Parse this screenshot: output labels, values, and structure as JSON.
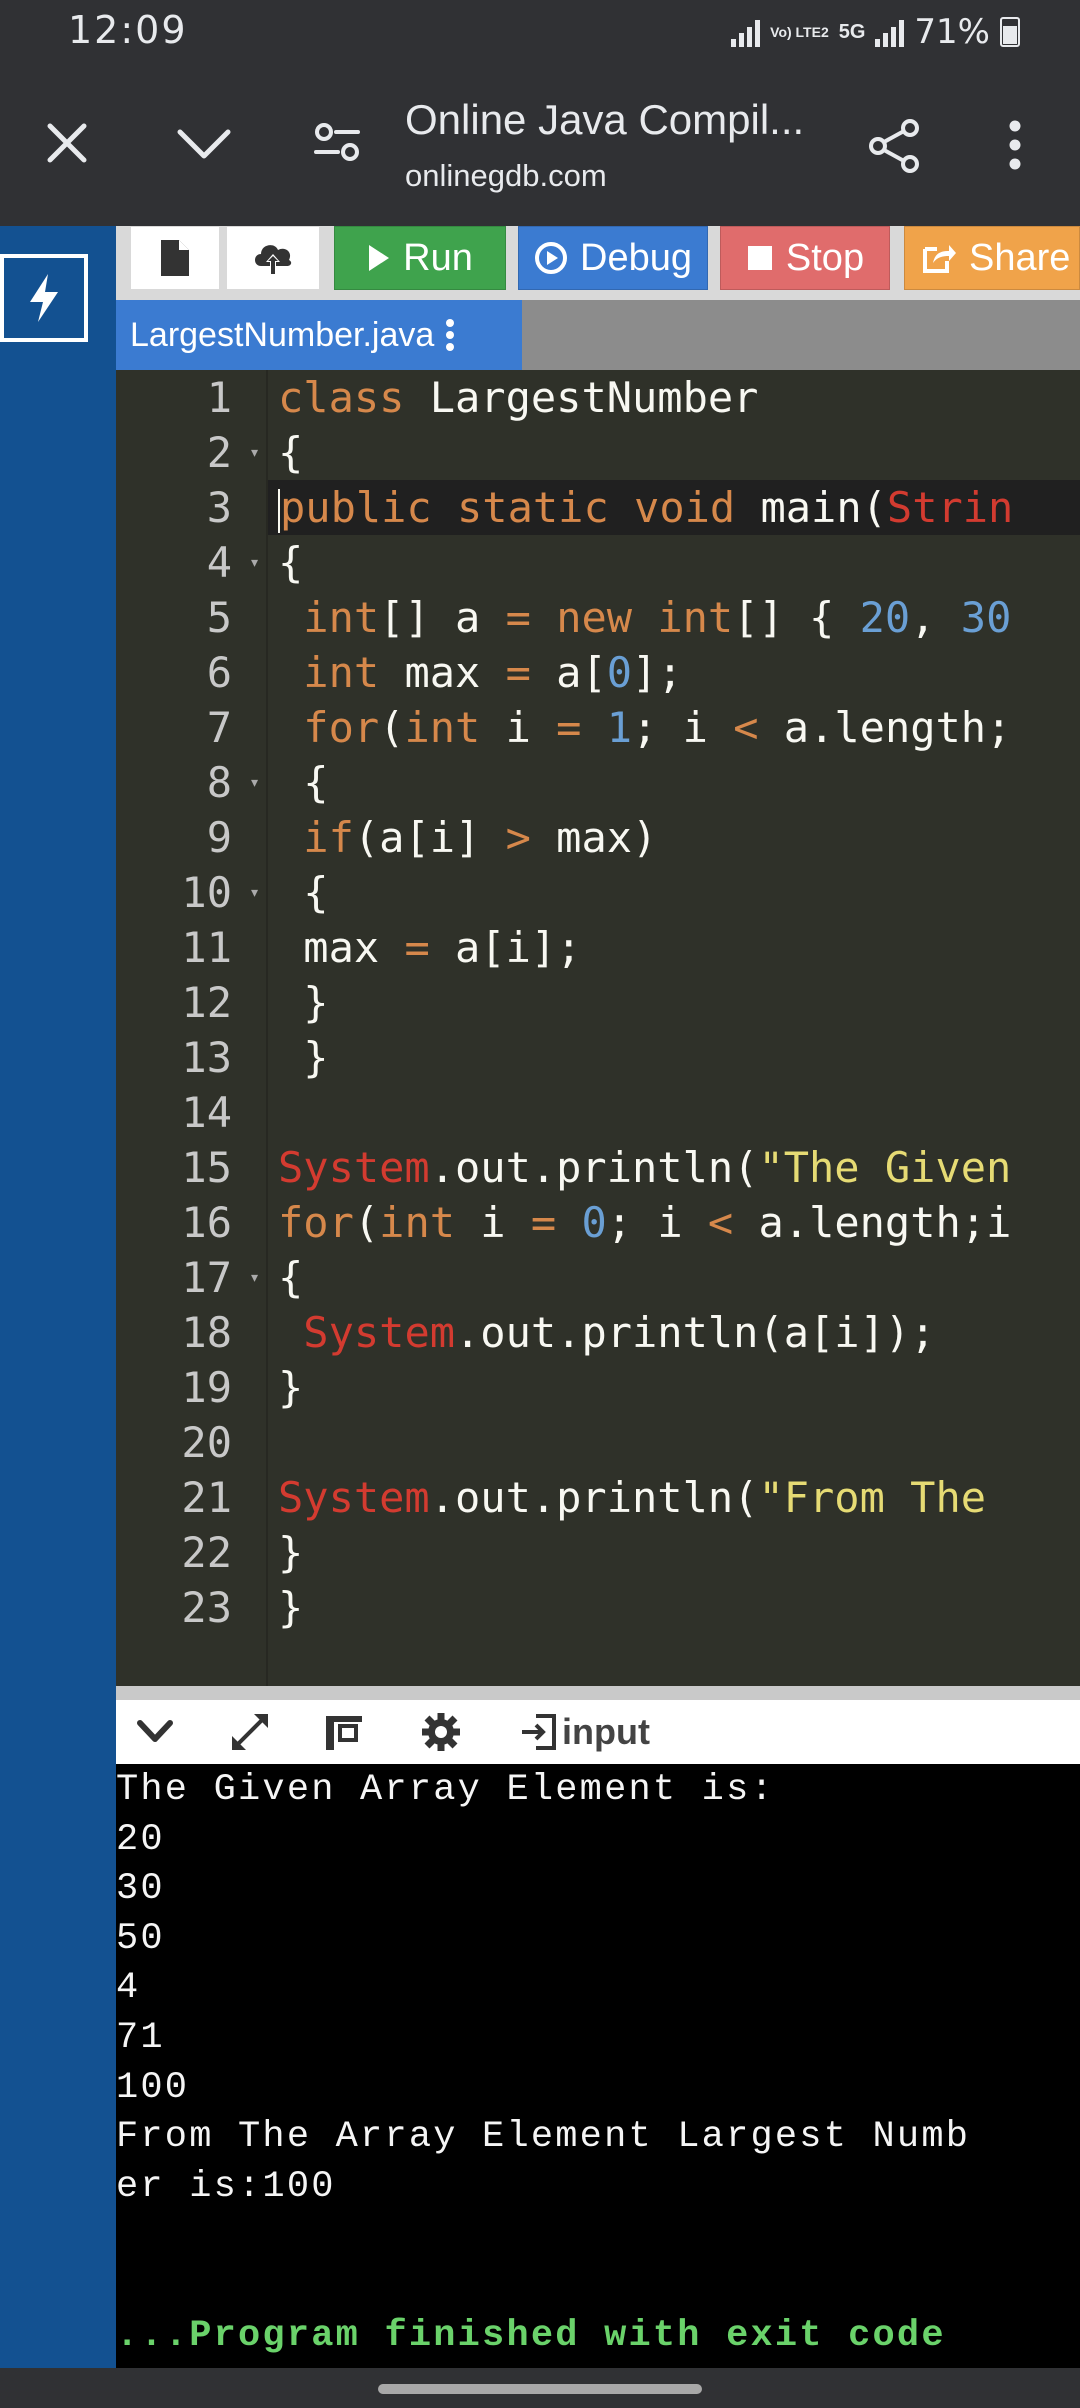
{
  "status": {
    "time": "12:09",
    "network": "Vo) LTE2",
    "network_type": "5G",
    "battery": "71%"
  },
  "browser": {
    "page_title": "Online Java Compil...",
    "url": "onlinegdb.com"
  },
  "toolbar": {
    "run_label": "Run",
    "debug_label": "Debug",
    "stop_label": "Stop",
    "share_label": "Share",
    "colors": {
      "run": "#3fa34d",
      "debug": "#3b7bd1",
      "stop": "#e06c6c",
      "share": "#f0a34a"
    }
  },
  "editor": {
    "file_tab": "LargestNumber.java",
    "line_numbers": [
      "1",
      "2",
      "3",
      "4",
      "5",
      "6",
      "7",
      "8",
      "9",
      "10",
      "11",
      "12",
      "13",
      "14",
      "15",
      "16",
      "17",
      "18",
      "19",
      "20",
      "21",
      "22",
      "23"
    ],
    "code_lines": [
      "class LargestNumber",
      "{",
      "public static void main(Strin",
      "{",
      " int[] a = new int[] { 20, 30",
      " int max = a[0];",
      " for(int i = 1; i < a.length;",
      " {",
      " if(a[i] > max)",
      " {",
      " max = a[i];",
      " }",
      " }",
      "",
      "System.out.println(\"The Given",
      "for(int i = 0; i < a.length;i",
      "{",
      " System.out.println(a[i]);",
      "}",
      "",
      "System.out.println(\"From The ",
      "}",
      "}"
    ]
  },
  "terminal": {
    "input_label": "input",
    "output_lines": [
      "The Given Array Element is:",
      "20",
      "30",
      "50",
      "4",
      "71",
      "100",
      "From The Array Element Largest Numb",
      "er is:100",
      "",
      "",
      "...Program finished with exit code"
    ]
  }
}
